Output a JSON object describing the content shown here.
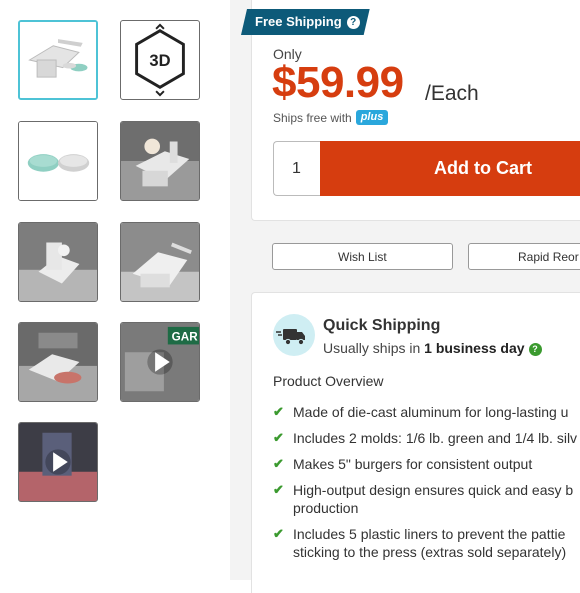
{
  "thumbnails": [
    {
      "name": "thumb-product-press",
      "kind": "image",
      "active": true
    },
    {
      "name": "thumb-3d-view",
      "kind": "3d",
      "label": "3D"
    },
    {
      "name": "thumb-molds",
      "kind": "image"
    },
    {
      "name": "thumb-press-in-use",
      "kind": "image"
    },
    {
      "name": "thumb-press-kitchen",
      "kind": "image"
    },
    {
      "name": "thumb-press-side",
      "kind": "image"
    },
    {
      "name": "thumb-press-patty",
      "kind": "image"
    },
    {
      "name": "thumb-video-1",
      "kind": "video",
      "caption": "GAR"
    },
    {
      "name": "thumb-video-2",
      "kind": "video"
    }
  ],
  "shipping_badge": {
    "label": "Free Shipping",
    "icon": "question-icon"
  },
  "price": {
    "prefix": "Only",
    "amount": "$59.99",
    "unit": "/Each",
    "ships_free_text": "Ships free with",
    "plus_label": "plus"
  },
  "cart": {
    "quantity": "1",
    "button_label": "Add to Cart"
  },
  "actions": {
    "wish_list": "Wish List",
    "rapid_reorder": "Rapid Reor"
  },
  "quick_shipping": {
    "title": "Quick Shipping",
    "subtitle_prefix": "Usually ships in",
    "subtitle_bold": "1 business day",
    "icon": "truck-icon"
  },
  "overview": {
    "heading": "Product Overview",
    "bullets": [
      "Made of die-cast aluminum for long-lasting u",
      "Includes 2 molds: 1/6 lb. green and 1/4 lb. silv",
      "Makes 5\" burgers for consistent output",
      "High-output design ensures quick and easy b",
      "production",
      "Includes 5 plastic liners to prevent the pattie",
      "sticking to the press (extras sold separately)"
    ]
  },
  "colors": {
    "accent": "#d63d0f",
    "badge": "#0d5a79",
    "check": "#3b9a2f",
    "active_thumb": "#4ec3d6"
  }
}
